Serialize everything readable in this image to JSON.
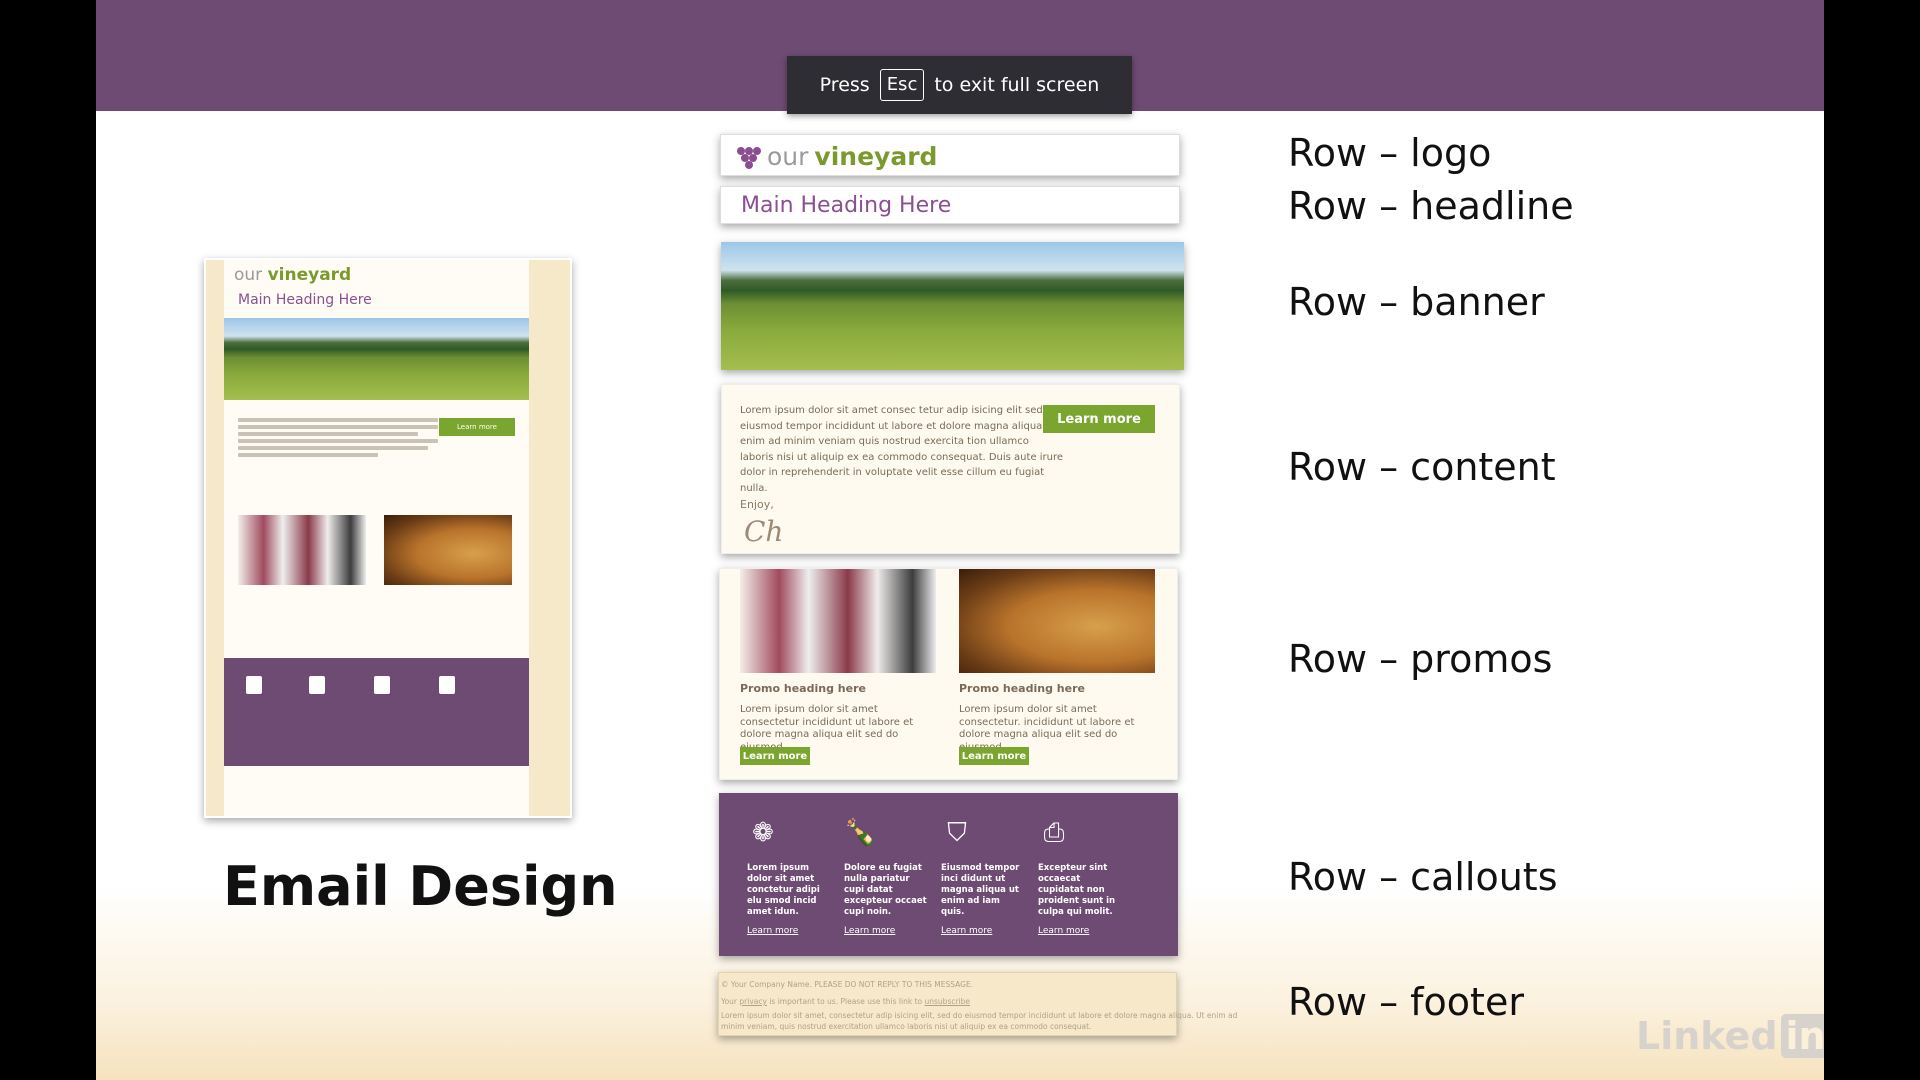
{
  "banner": {
    "press": "Press",
    "key": "Esc",
    "rest": "to exit full screen"
  },
  "preview": {
    "logo_light": "our",
    "logo_bold": "vineyard",
    "heading": "Main Heading Here",
    "learn_more": "Learn more"
  },
  "rows": {
    "logo": {
      "light": "our",
      "bold": "vineyard"
    },
    "headline": "Main Heading Here",
    "content": {
      "paragraph": "Lorem ipsum dolor sit amet consec tetur adip isicing elit sed do eiusmod tempor incididunt ut labore et dolore magna aliqua. Ut enim ad minim veniam quis nostrud exercita tion ullamco laboris nisi ut aliquip ex ea commodo consequat. Duis aute irure dolor in reprehenderit in voluptate velit esse cillum eu fugiat nulla.",
      "enjoy": "Enjoy,",
      "signature": "Ch",
      "button": "Learn more"
    },
    "promos": [
      {
        "heading": "Promo heading here",
        "text": "Lorem ipsum dolor sit amet consectetur incididunt ut labore et dolore magna aliqua elit sed do eiusmod.",
        "button": "Learn more"
      },
      {
        "heading": "Promo heading here",
        "text": "Lorem ipsum dolor sit amet consectetur. incididunt ut labore et dolore magna aliqua elit sed do eiusmod.",
        "button": "Learn more"
      }
    ],
    "callouts": [
      {
        "icon": "grapes-icon",
        "text": "Lorem ipsum dolor sit amet conctetur adipi elu smod incid amet idun.",
        "link": "Learn more"
      },
      {
        "icon": "wine-bottle-icon",
        "text": "Dolore eu fugiat nulla pariatur cupi datat excepteur occaet cupi noin.",
        "link": "Learn more"
      },
      {
        "icon": "basket-icon",
        "text": "Eiusmod tempor inci didunt ut magna aliqua ut enim ad iam quis.",
        "link": "Learn more"
      },
      {
        "icon": "camera-icon",
        "text": "Excepteur sint occaecat cupidatat non proident sunt in culpa qui molit.",
        "link": "Learn more"
      }
    ],
    "footer": {
      "line1": "© Your Company Name. PLEASE DO NOT REPLY TO THIS MESSAGE.",
      "line2_pre": "Your",
      "line2_link1": "privacy",
      "line2_mid": "is important to us. Please use this link to",
      "line2_link2": "unsubscribe",
      "line3": "Lorem ipsum dolor sit amet, consectetur adip isicing elit, sed do eiusmod tempor incididunt ut labore et dolore magna aliqua. Ut enim ad",
      "line4": "minim veniam, quis nostrud exercitation ullamco laboris nisi ut aliquip ex ea commodo consequat."
    }
  },
  "labels": {
    "logo": "Row – logo",
    "headline": "Row – headline",
    "banner": "Row – banner",
    "content": "Row – content",
    "promos": "Row – promos",
    "callouts": "Row – callouts",
    "footer": "Row – footer"
  },
  "caption": "Email Design",
  "watermark": {
    "linked": "Linked",
    "in": "in"
  },
  "colors": {
    "header_purple": "#6e4b73",
    "accent_green": "#7aa52e",
    "heading_purple": "#8a4f91"
  }
}
